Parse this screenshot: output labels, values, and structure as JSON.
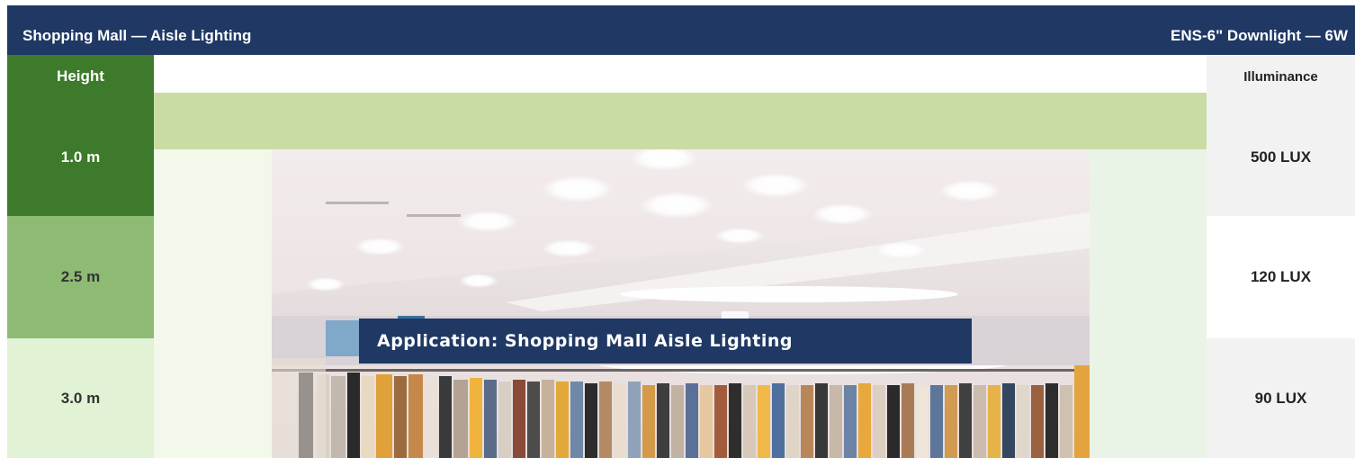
{
  "header": {
    "application_title": "Shopping Mall — Aisle Lighting",
    "product_title": "ENS-6\" Downlight — 6W"
  },
  "height_column": {
    "heading": "Height",
    "rows": [
      "1.0 m",
      "2.5 m",
      "3.0 m"
    ]
  },
  "illuminance_column": {
    "heading": "Illuminance",
    "rows": [
      "500 LUX",
      "120 LUX",
      "90 LUX"
    ]
  },
  "photo": {
    "caption": "Application: Shopping Mall Aisle Lighting"
  },
  "colors": {
    "header_navy": "#1f3864",
    "dark_green": "#3d7a2b",
    "mid_green": "#8dbb74",
    "light_green": "#e1f2d5",
    "band_green": "#c9dca3"
  }
}
